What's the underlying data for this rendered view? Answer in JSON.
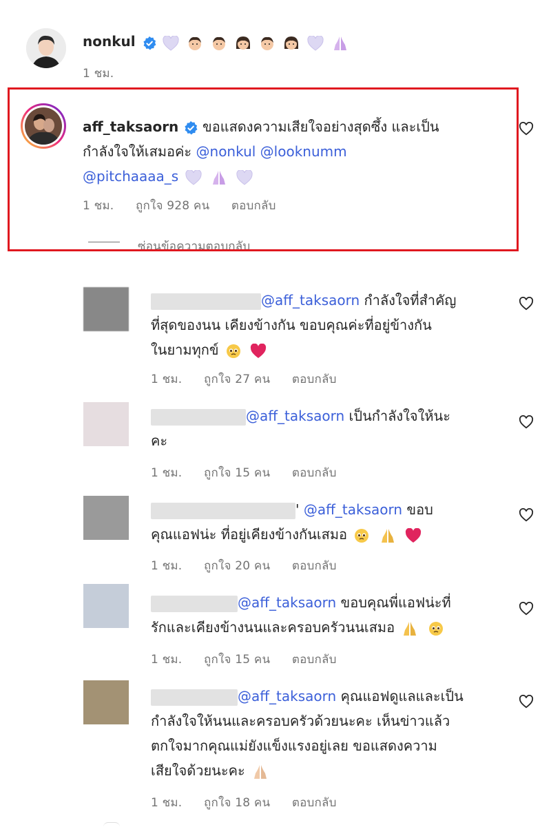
{
  "top_comment": {
    "username": "nonkul",
    "time": "1 ชม."
  },
  "highlighted_comment": {
    "username": "aff_taksaorn",
    "text_line1": "ขอแสดงความเสียใจอย่างสุดซึ้ง และเป็น",
    "text_line2_pre": "กำลังใจให้เสมอค่ะ ",
    "mention1": "@nonkul",
    "mention2": "@looknumm",
    "mention3": "@pitchaaaa_s",
    "time": "1 ชม.",
    "likes": "ถูกใจ 928 คน",
    "reply": "ตอบกลับ",
    "hide_replies": "ซ่อนข้อความตอบกลับ"
  },
  "replies": [
    {
      "mention": "@aff_taksaorn",
      "line1": " กำลังใจที่สำคัญ",
      "line2": "ที่สุดของนน เคียงข้างกัน ขอบคุณค่ะที่อยู่ข้างกัน",
      "line3": "ในยามทุกข์",
      "time": "1 ชม.",
      "likes": "ถูกใจ 27 คน",
      "reply": "ตอบกลับ"
    },
    {
      "mention": "@aff_taksaorn",
      "line1": " เป็นกำลังใจให้นะ",
      "line2": "คะ",
      "time": "1 ชม.",
      "likes": "ถูกใจ 15 คน",
      "reply": "ตอบกลับ"
    },
    {
      "mention": "@aff_taksaorn",
      "line1": " ขอบ",
      "line2": "คุณแอฟน่ะ ที่อยู่เคียงข้างกันเสมอ",
      "time": "1 ชม.",
      "likes": "ถูกใจ 20 คน",
      "reply": "ตอบกลับ"
    },
    {
      "mention": "@aff_taksaorn",
      "line1": " ขอบคุณพี่แอฟน่ะที่",
      "line2": "รักและเคียงข้างนนและครอบครัวนนเสมอ",
      "time": "1 ชม.",
      "likes": "ถูกใจ 15 คน",
      "reply": "ตอบกลับ"
    },
    {
      "mention": "@aff_taksaorn",
      "line1": " คุณแอฟดูแลและเป็น",
      "line2": "กำลังใจให้นนและครอบครัวด้วยนะคะ เห็นข่าวแล้ว",
      "line3": "ตกใจมากคุณแม่ยังแข็งแรงอยู่เลย ขอแสดงความ",
      "line4": "เสียใจด้วยนะคะ",
      "time": "1 ชม.",
      "likes": "ถูกใจ 18 คน",
      "reply": "ตอบกลับ"
    }
  ],
  "colors": {
    "highlight_border": "#e0181f",
    "mention": "#3b5fd9",
    "verified": "#2f8cf0",
    "meta": "#737373"
  }
}
